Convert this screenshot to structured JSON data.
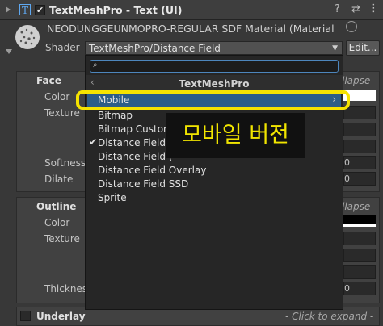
{
  "header": {
    "title": "TextMeshPro - Text (UI)",
    "help_icon": "help-icon",
    "settings_icon": "sliders-icon",
    "more_icon": "more-icon"
  },
  "material": {
    "name": "NEODUNGGEUNMOPRO-REGULAR SDF Material (Material",
    "shader_label": "Shader",
    "shader_value": "TextMeshPro/Distance Field",
    "edit_label": "Edit..."
  },
  "face": {
    "title": "Face",
    "collapse": "llapse -",
    "color_label": "Color",
    "texture_label": "Texture",
    "softness_label": "Softness",
    "softness_value": "0",
    "dilate_label": "Dilate",
    "dilate_value": "0"
  },
  "outline": {
    "title": "Outline",
    "collapse": "llapse -",
    "color_label": "Color",
    "texture_label": "Texture",
    "thickness_label": "Thicknes",
    "thickness_value": "0"
  },
  "underlay": {
    "title": "Underlay",
    "expand": "- Click to expand -"
  },
  "menu": {
    "search_placeholder": "",
    "category": "TextMeshPro",
    "items": [
      "Mobile",
      "Bitmap",
      "Bitmap Custom",
      "Distance Field",
      "Distance Field (",
      "Distance Field Overlay",
      "Distance Field SSD",
      "Sprite"
    ],
    "checked": "Distance Field",
    "highlighted": "Mobile"
  },
  "annotation": {
    "text": "모바일 버전",
    "color": "#f1e500"
  },
  "colors": {
    "accent": "#2c5d87",
    "highlight_box": "#f6e300"
  }
}
